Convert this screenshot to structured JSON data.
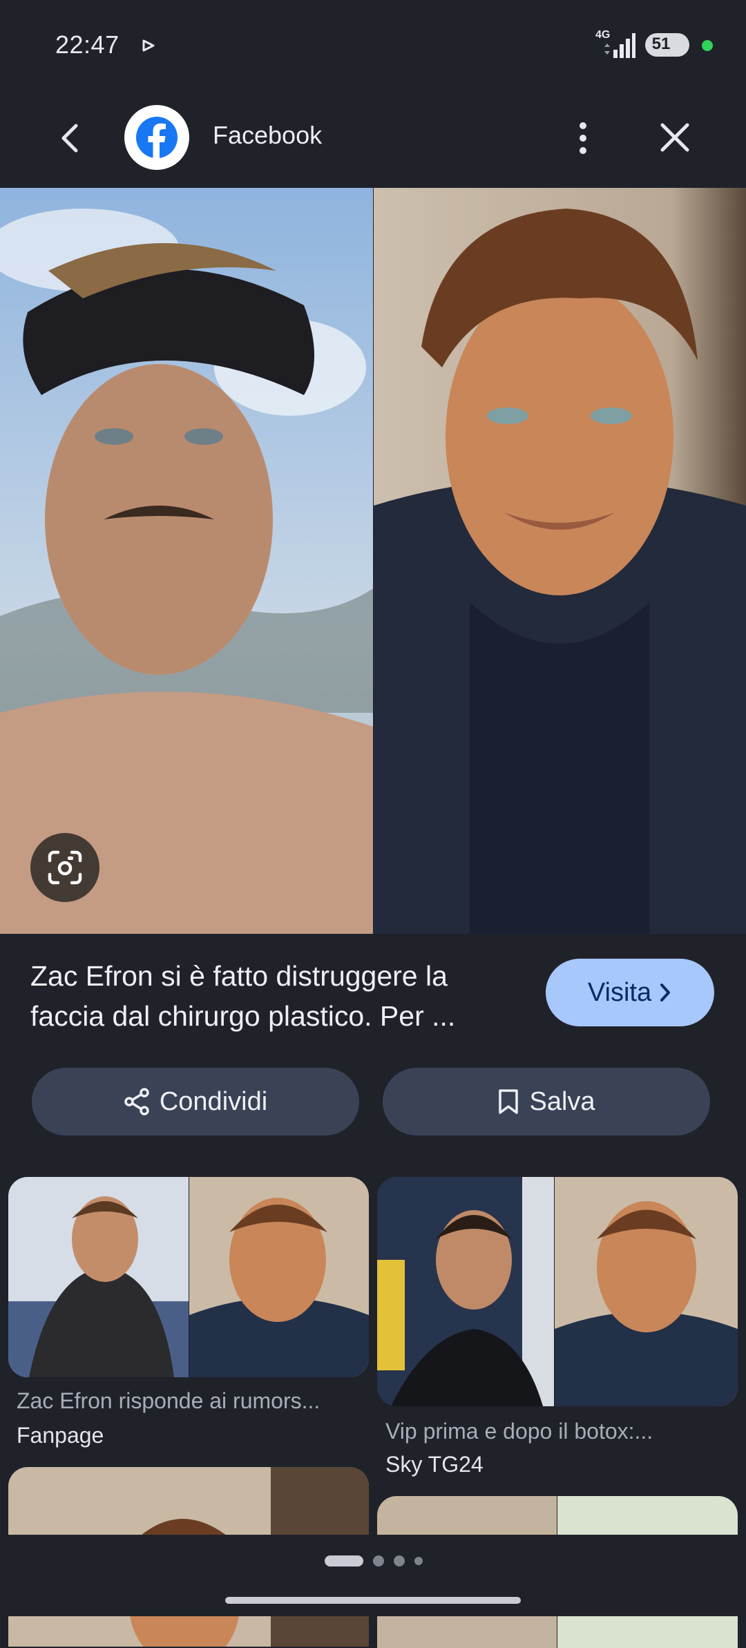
{
  "status_bar": {
    "time": "22:47",
    "network": "4G",
    "battery": "51",
    "icons": [
      "play-icon",
      "signal-icon",
      "battery-icon"
    ]
  },
  "header": {
    "title": "Facebook",
    "icons": [
      "back-icon",
      "facebook-logo-icon",
      "more-vert-icon",
      "close-icon"
    ]
  },
  "main": {
    "caption": "Zac Efron si è fatto distruggere la faccia dal chirurgo plastico. Per ...",
    "visit_label": "Visita",
    "share_label": "Condividi",
    "save_label": "Salva"
  },
  "related": [
    {
      "title": "Zac Efron risponde ai rumors...",
      "source": "Fanpage"
    },
    {
      "title": "Vip prima e dopo il botox:...",
      "source": "Sky TG24"
    }
  ],
  "colors": {
    "background": "#20222a",
    "visit_button": "#a8c7fa",
    "action_button": "#3a4356",
    "facebook_blue": "#1877f2",
    "status_dot": "#2fd35a"
  }
}
